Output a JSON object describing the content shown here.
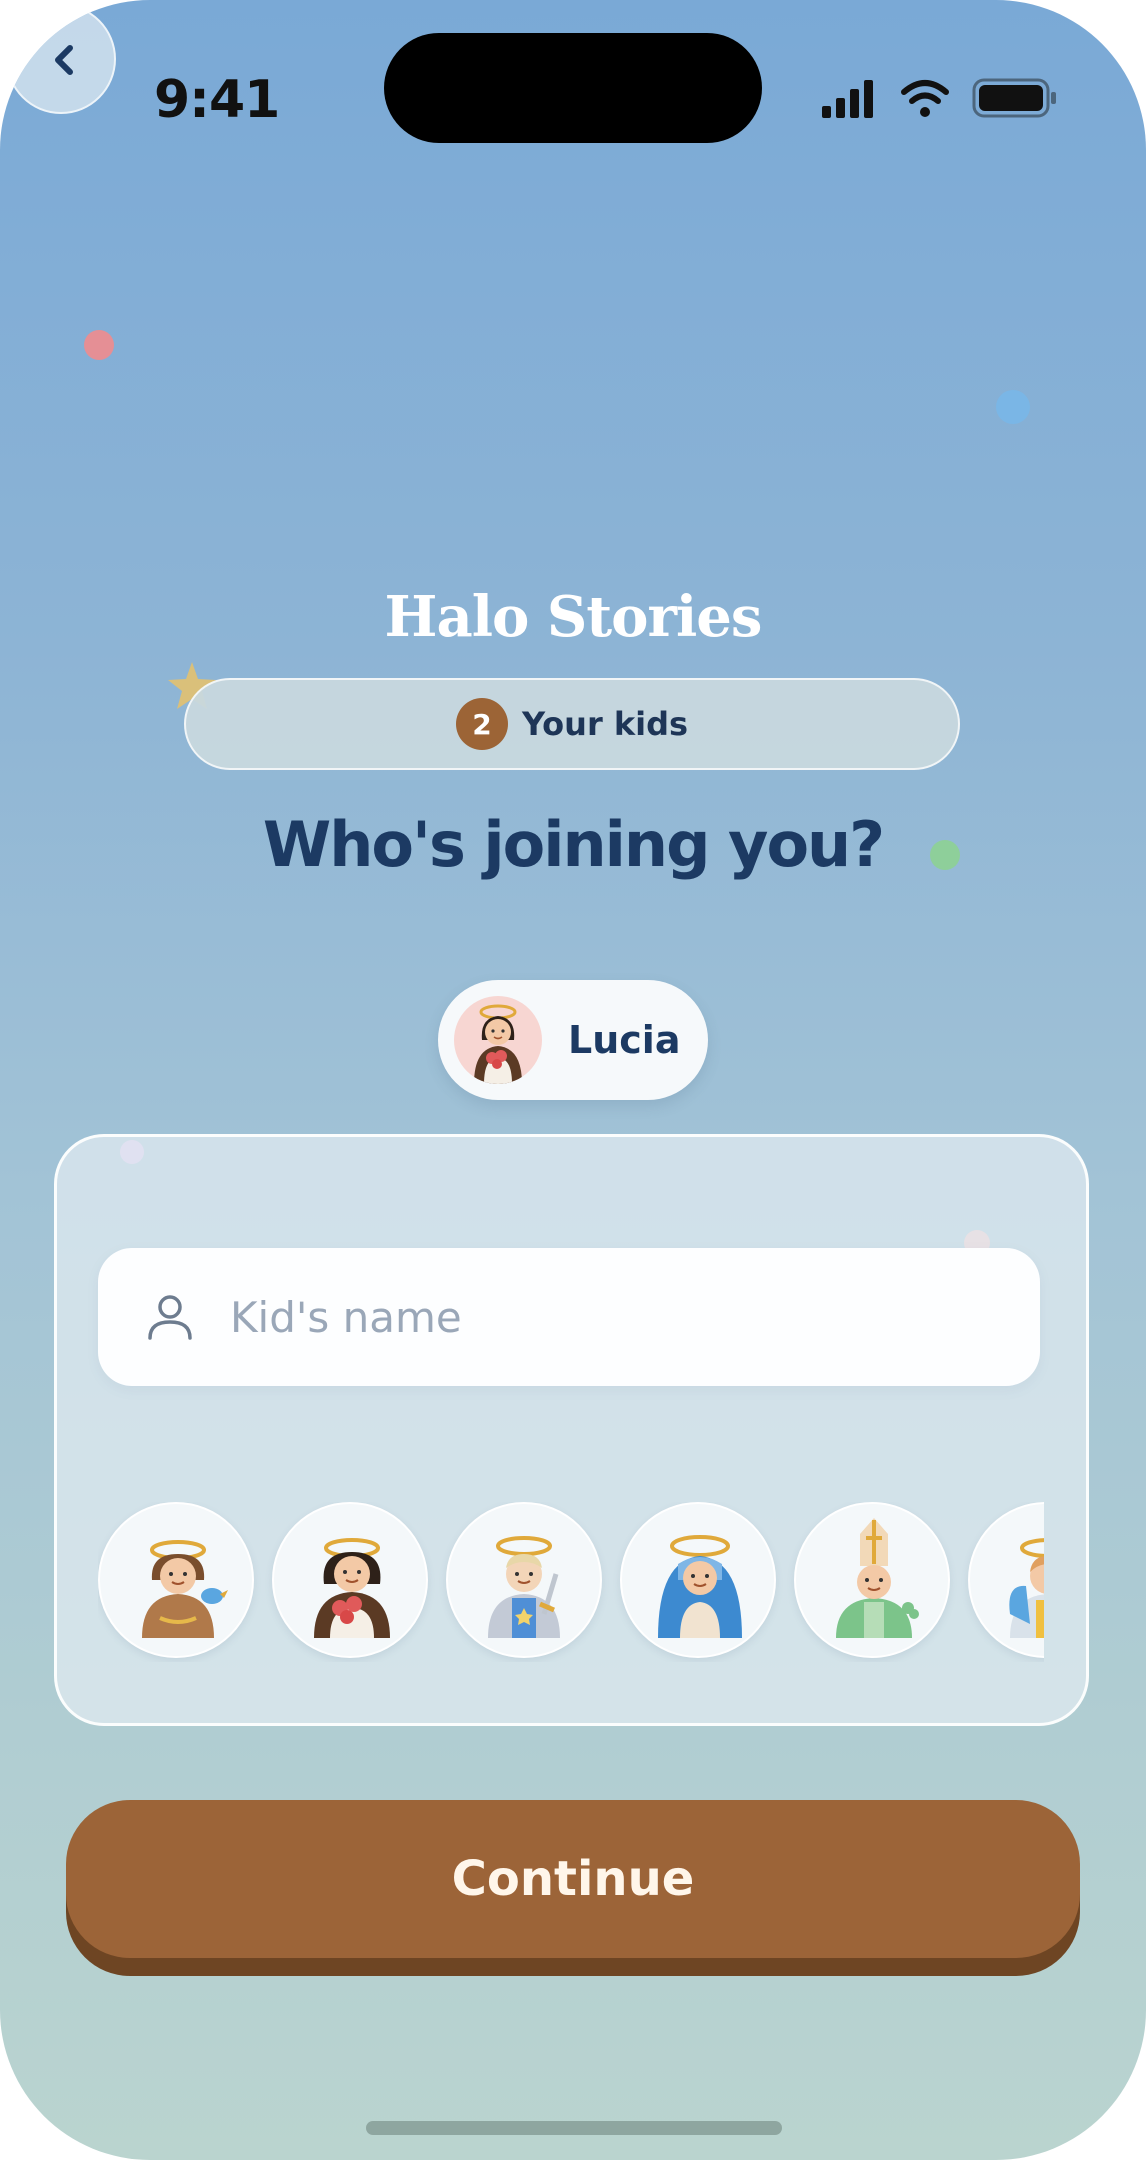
{
  "status_bar": {
    "time": "9:41"
  },
  "header": {
    "app_title": "Halo Stories"
  },
  "step": {
    "number": "2",
    "label": "Your kids"
  },
  "headline": "Who's joining you?",
  "added_kids": [
    {
      "name": "Lucia",
      "avatar": "saint-with-roses-avatar"
    }
  ],
  "form": {
    "name_placeholder": "Kid's name",
    "name_value": "",
    "avatars": [
      "saint-with-bluebird-avatar",
      "saint-with-roses-avatar",
      "saint-with-sword-avatar",
      "saint-blue-veil-avatar",
      "saint-bishop-mitre-avatar",
      "saint-blue-cape-avatar"
    ]
  },
  "continue_label": "Continue",
  "colors": {
    "accent": "#9c6438",
    "heading": "#1c3a63",
    "background_top": "#7aa9d6",
    "background_bottom": "#bad4cf"
  }
}
